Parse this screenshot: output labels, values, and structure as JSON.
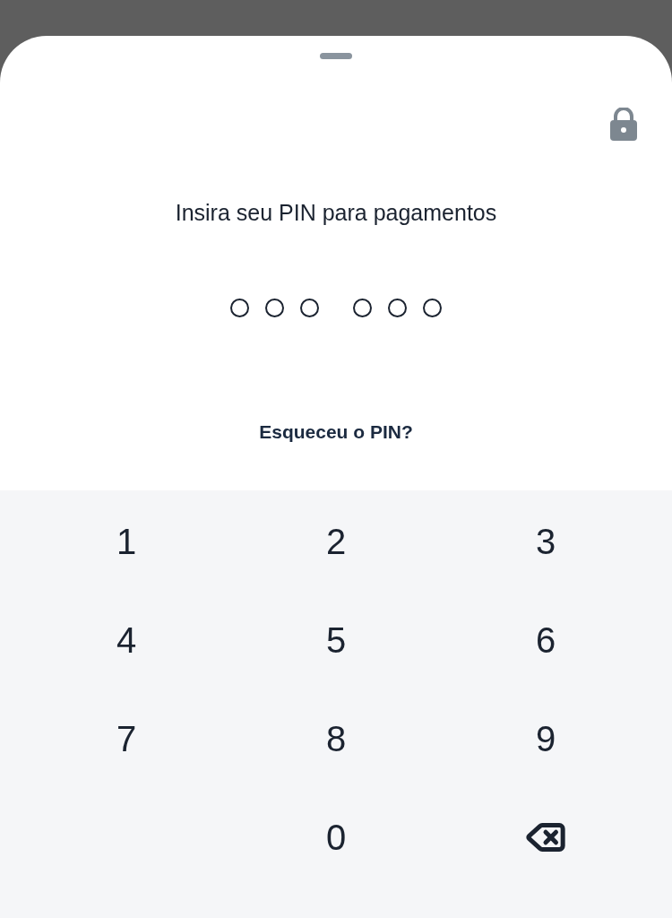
{
  "title": "Insira seu PIN para pagamentos",
  "pin_dots": [
    {
      "filled": false
    },
    {
      "filled": false
    },
    {
      "filled": false
    },
    {
      "filled": false
    },
    {
      "filled": false
    },
    {
      "filled": false
    }
  ],
  "forgot_link": "Esqueceu o PIN?",
  "keys": [
    {
      "kind": "digit",
      "label": "1"
    },
    {
      "kind": "digit",
      "label": "2"
    },
    {
      "kind": "digit",
      "label": "3"
    },
    {
      "kind": "digit",
      "label": "4"
    },
    {
      "kind": "digit",
      "label": "5"
    },
    {
      "kind": "digit",
      "label": "6"
    },
    {
      "kind": "digit",
      "label": "7"
    },
    {
      "kind": "digit",
      "label": "8"
    },
    {
      "kind": "digit",
      "label": "9"
    },
    {
      "kind": "digit",
      "label": "0"
    },
    {
      "kind": "backspace"
    }
  ]
}
